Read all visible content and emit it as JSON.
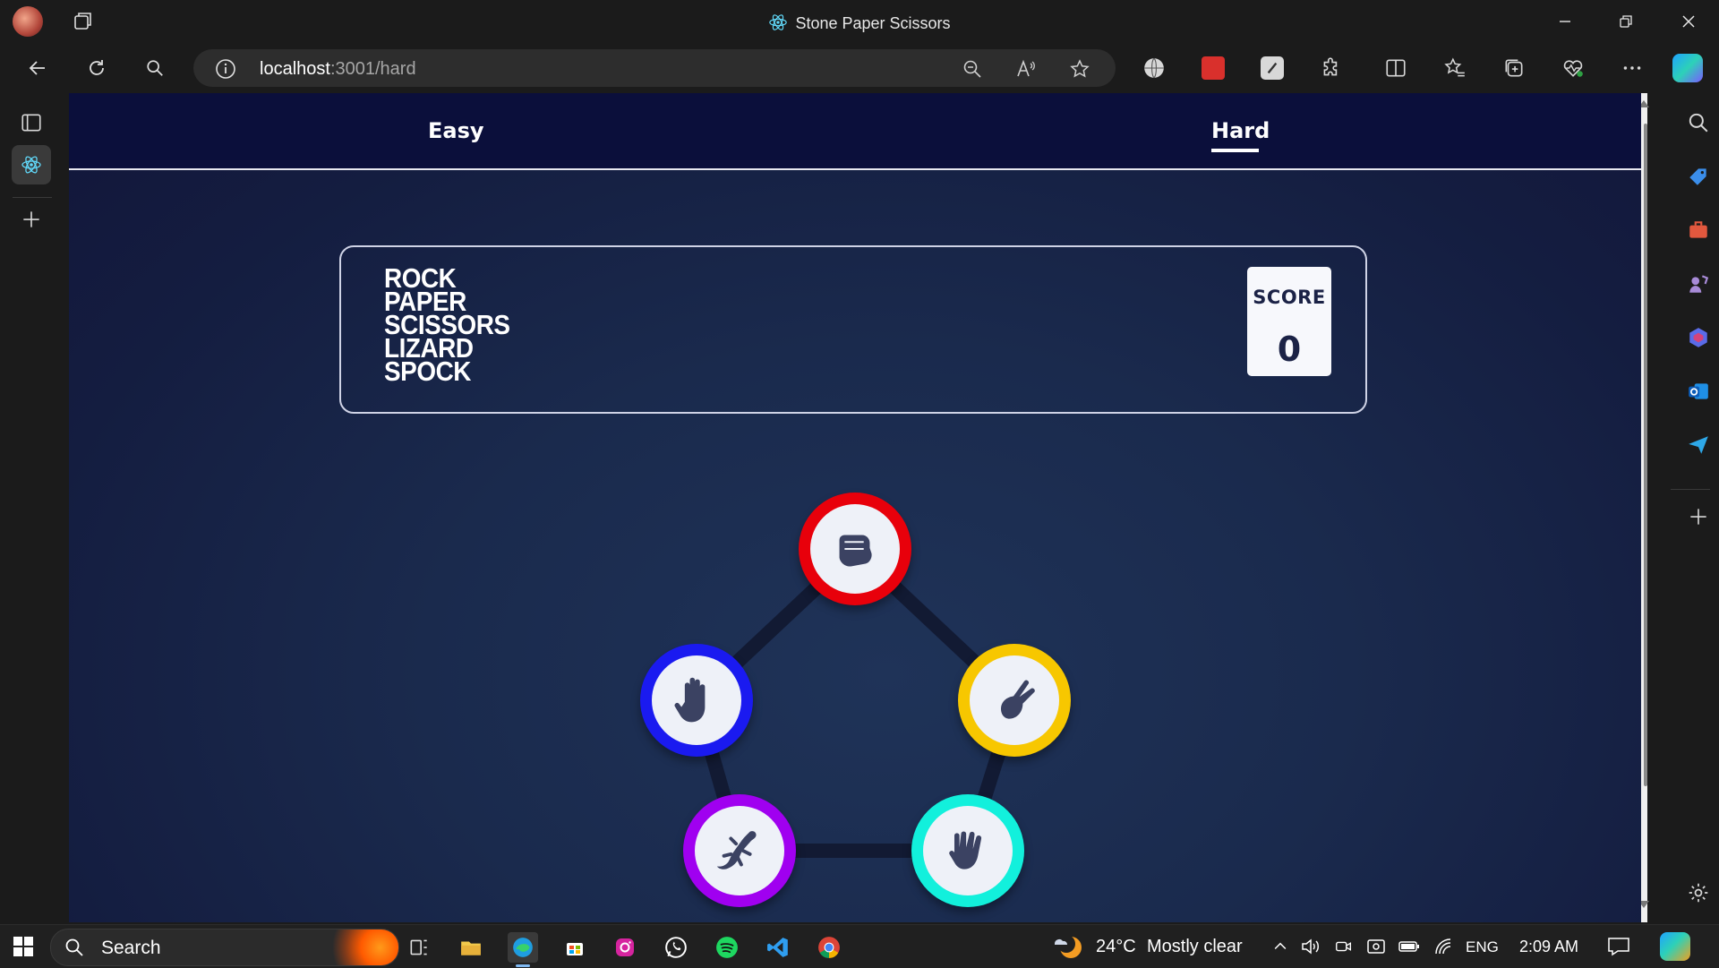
{
  "browser": {
    "window_title": "Stone Paper Scissors",
    "url_host": "localhost",
    "url_rest": ":3001/hard"
  },
  "nav": {
    "easy_label": "Easy",
    "hard_label": "Hard",
    "active": "Hard"
  },
  "game": {
    "logo_lines": [
      "ROCK",
      "PAPER",
      "SCISSORS",
      "LIZARD",
      "SPOCK"
    ],
    "score_label": "SCORE",
    "score_value": "0",
    "tokens": [
      {
        "name": "rock",
        "color": "#e8000b",
        "icon": "fist-icon"
      },
      {
        "name": "paper",
        "color": "#1a1af0",
        "icon": "open-hand-icon"
      },
      {
        "name": "scissors",
        "color": "#f7c700",
        "icon": "scissors-hand-icon"
      },
      {
        "name": "lizard",
        "color": "#a000f0",
        "icon": "lizard-icon"
      },
      {
        "name": "spock",
        "color": "#12f0dc",
        "icon": "spock-hand-icon"
      }
    ]
  },
  "taskbar": {
    "search_label": "Search",
    "weather_temp": "24°C",
    "weather_text": "Mostly clear",
    "language": "ENG",
    "time": "2:09 AM"
  }
}
